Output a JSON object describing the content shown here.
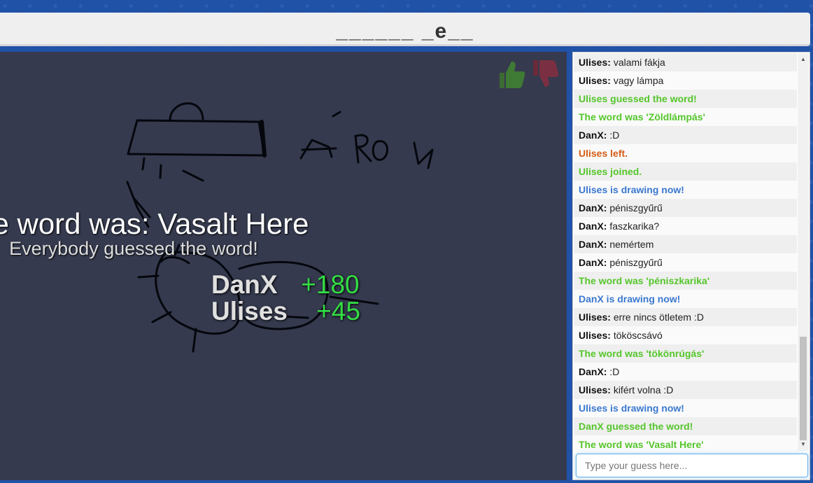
{
  "word_hint": "______ _e__",
  "canvas": {
    "vote_up_icon": "thumbs-up-icon",
    "vote_down_icon": "thumbs-down-icon",
    "result_title": "The word was: Vasalt Here",
    "result_subtitle": "Everybody guessed the word!",
    "scores": [
      {
        "name": "DanX",
        "points": "+180"
      },
      {
        "name": "Ulises",
        "points": "+45"
      }
    ]
  },
  "chat": {
    "messages": [
      {
        "author": "Ulises:",
        "text": "valami fákja",
        "type": "user"
      },
      {
        "author": "Ulises:",
        "text": "vagy lámpa",
        "type": "user"
      },
      {
        "text": "Ulises guessed the word!",
        "type": "green"
      },
      {
        "text": "The word was 'Zöldlámpás'",
        "type": "green"
      },
      {
        "author": "DanX:",
        "text": ":D",
        "type": "user"
      },
      {
        "text": "Ulises left.",
        "type": "orange"
      },
      {
        "text": "Ulises joined.",
        "type": "green"
      },
      {
        "text": "Ulises is drawing now!",
        "type": "blue"
      },
      {
        "author": "DanX:",
        "text": "péniszgyűrű",
        "type": "user"
      },
      {
        "author": "DanX:",
        "text": "faszkarika?",
        "type": "user"
      },
      {
        "author": "DanX:",
        "text": "nemértem",
        "type": "user"
      },
      {
        "author": "DanX:",
        "text": "péniszgyűrű",
        "type": "user"
      },
      {
        "text": "The word was 'péniszkarika'",
        "type": "green"
      },
      {
        "text": "DanX is drawing now!",
        "type": "blue"
      },
      {
        "author": "Ulises:",
        "text": "erre nincs ötletem :D",
        "type": "user"
      },
      {
        "author": "Ulises:",
        "text": "tököscsávó",
        "type": "user"
      },
      {
        "text": "The word was 'tökönrúgás'",
        "type": "green"
      },
      {
        "author": "DanX:",
        "text": ":D",
        "type": "user"
      },
      {
        "author": "Ulises:",
        "text": "kifért volna :D",
        "type": "user"
      },
      {
        "text": "Ulises is drawing now!",
        "type": "blue"
      },
      {
        "text": "DanX guessed the word!",
        "type": "green"
      },
      {
        "text": "The word was 'Vasalt Here'",
        "type": "green"
      }
    ],
    "input_placeholder": "Type your guess here...",
    "input_value": ""
  },
  "colors": {
    "background": "#2052a8",
    "canvas": "#353a4e",
    "guessed_green": "#55c62b",
    "drawing_blue": "#3a78d0",
    "left_orange": "#d65a14",
    "score_green": "#33dd44"
  }
}
